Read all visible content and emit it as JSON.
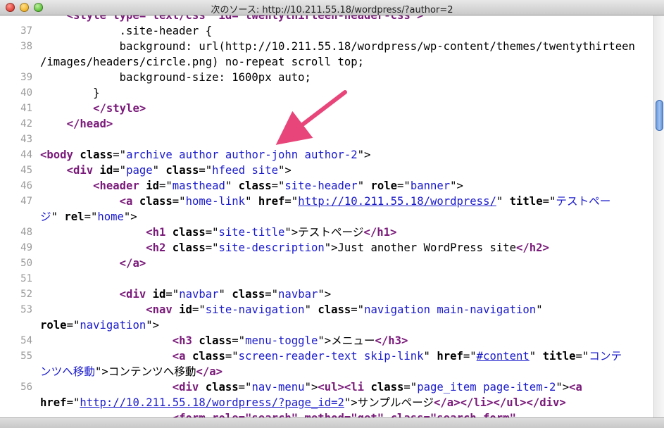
{
  "window": {
    "title": "次のソース: http://10.211.55.18/wordpress/?author=2",
    "traffic_lights": [
      "close",
      "minimize",
      "zoom"
    ]
  },
  "code_lines": [
    {
      "n": "",
      "parts": [
        {
          "t": "    <style type=\"text/css\" id=\"twentythirteen-header-css\">",
          "c": "tag"
        }
      ]
    },
    {
      "n": "37",
      "parts": [
        {
          "t": "            .site-header {",
          "c": "plain"
        }
      ]
    },
    {
      "n": "38",
      "parts": [
        {
          "t": "            background: url(http://10.211.55.18/wordpress/wp-content/themes/twentythirteen",
          "c": "plain"
        }
      ]
    },
    {
      "n": "",
      "parts": [
        {
          "t": "/images/headers/circle.png) no-repeat scroll top;",
          "c": "plain"
        }
      ]
    },
    {
      "n": "39",
      "parts": [
        {
          "t": "            background-size: 1600px auto;",
          "c": "plain"
        }
      ]
    },
    {
      "n": "40",
      "parts": [
        {
          "t": "        }",
          "c": "plain"
        }
      ]
    },
    {
      "n": "41",
      "parts": [
        {
          "t": "        ",
          "c": "plain"
        },
        {
          "t": "</style>",
          "c": "tag"
        }
      ]
    },
    {
      "n": "42",
      "parts": [
        {
          "t": "    ",
          "c": "plain"
        },
        {
          "t": "</head>",
          "c": "tag"
        }
      ]
    },
    {
      "n": "43",
      "parts": []
    },
    {
      "n": "44",
      "parts": [
        {
          "t": "<body ",
          "c": "tag"
        },
        {
          "t": "class",
          "c": "attr"
        },
        {
          "t": "=\"",
          "c": "plain"
        },
        {
          "t": "archive author author-john author-2",
          "c": "val"
        },
        {
          "t": "\">",
          "c": "plain"
        }
      ]
    },
    {
      "n": "45",
      "parts": [
        {
          "t": "    ",
          "c": "plain"
        },
        {
          "t": "<div ",
          "c": "tag"
        },
        {
          "t": "id",
          "c": "attr"
        },
        {
          "t": "=\"",
          "c": "plain"
        },
        {
          "t": "page",
          "c": "val"
        },
        {
          "t": "\" ",
          "c": "plain"
        },
        {
          "t": "class",
          "c": "attr"
        },
        {
          "t": "=\"",
          "c": "plain"
        },
        {
          "t": "hfeed site",
          "c": "val"
        },
        {
          "t": "\">",
          "c": "plain"
        }
      ]
    },
    {
      "n": "46",
      "parts": [
        {
          "t": "        ",
          "c": "plain"
        },
        {
          "t": "<header ",
          "c": "tag"
        },
        {
          "t": "id",
          "c": "attr"
        },
        {
          "t": "=\"",
          "c": "plain"
        },
        {
          "t": "masthead",
          "c": "val"
        },
        {
          "t": "\" ",
          "c": "plain"
        },
        {
          "t": "class",
          "c": "attr"
        },
        {
          "t": "=\"",
          "c": "plain"
        },
        {
          "t": "site-header",
          "c": "val"
        },
        {
          "t": "\" ",
          "c": "plain"
        },
        {
          "t": "role",
          "c": "attr"
        },
        {
          "t": "=\"",
          "c": "plain"
        },
        {
          "t": "banner",
          "c": "val"
        },
        {
          "t": "\">",
          "c": "plain"
        }
      ]
    },
    {
      "n": "47",
      "parts": [
        {
          "t": "            ",
          "c": "plain"
        },
        {
          "t": "<a ",
          "c": "tag"
        },
        {
          "t": "class",
          "c": "attr"
        },
        {
          "t": "=\"",
          "c": "plain"
        },
        {
          "t": "home-link",
          "c": "val"
        },
        {
          "t": "\" ",
          "c": "plain"
        },
        {
          "t": "href",
          "c": "attr"
        },
        {
          "t": "=\"",
          "c": "plain"
        },
        {
          "t": "http://10.211.55.18/wordpress/",
          "c": "url"
        },
        {
          "t": "\" ",
          "c": "plain"
        },
        {
          "t": "title",
          "c": "attr"
        },
        {
          "t": "=\"",
          "c": "plain"
        },
        {
          "t": "テストペー",
          "c": "val"
        }
      ]
    },
    {
      "n": "",
      "parts": [
        {
          "t": "ジ",
          "c": "val"
        },
        {
          "t": "\" ",
          "c": "plain"
        },
        {
          "t": "rel",
          "c": "attr"
        },
        {
          "t": "=\"",
          "c": "plain"
        },
        {
          "t": "home",
          "c": "val"
        },
        {
          "t": "\">",
          "c": "plain"
        }
      ]
    },
    {
      "n": "48",
      "parts": [
        {
          "t": "                ",
          "c": "plain"
        },
        {
          "t": "<h1 ",
          "c": "tag"
        },
        {
          "t": "class",
          "c": "attr"
        },
        {
          "t": "=\"",
          "c": "plain"
        },
        {
          "t": "site-title",
          "c": "val"
        },
        {
          "t": "\">テストページ",
          "c": "plain"
        },
        {
          "t": "</h1>",
          "c": "tag"
        }
      ]
    },
    {
      "n": "49",
      "parts": [
        {
          "t": "                ",
          "c": "plain"
        },
        {
          "t": "<h2 ",
          "c": "tag"
        },
        {
          "t": "class",
          "c": "attr"
        },
        {
          "t": "=\"",
          "c": "plain"
        },
        {
          "t": "site-description",
          "c": "val"
        },
        {
          "t": "\">Just another WordPress site",
          "c": "plain"
        },
        {
          "t": "</h2>",
          "c": "tag"
        }
      ]
    },
    {
      "n": "50",
      "parts": [
        {
          "t": "            ",
          "c": "plain"
        },
        {
          "t": "</a>",
          "c": "tag"
        }
      ]
    },
    {
      "n": "51",
      "parts": []
    },
    {
      "n": "52",
      "parts": [
        {
          "t": "            ",
          "c": "plain"
        },
        {
          "t": "<div ",
          "c": "tag"
        },
        {
          "t": "id",
          "c": "attr"
        },
        {
          "t": "=\"",
          "c": "plain"
        },
        {
          "t": "navbar",
          "c": "val"
        },
        {
          "t": "\" ",
          "c": "plain"
        },
        {
          "t": "class",
          "c": "attr"
        },
        {
          "t": "=\"",
          "c": "plain"
        },
        {
          "t": "navbar",
          "c": "val"
        },
        {
          "t": "\">",
          "c": "plain"
        }
      ]
    },
    {
      "n": "53",
      "parts": [
        {
          "t": "                ",
          "c": "plain"
        },
        {
          "t": "<nav ",
          "c": "tag"
        },
        {
          "t": "id",
          "c": "attr"
        },
        {
          "t": "=\"",
          "c": "plain"
        },
        {
          "t": "site-navigation",
          "c": "val"
        },
        {
          "t": "\" ",
          "c": "plain"
        },
        {
          "t": "class",
          "c": "attr"
        },
        {
          "t": "=\"",
          "c": "plain"
        },
        {
          "t": "navigation main-navigation",
          "c": "val"
        },
        {
          "t": "\"",
          "c": "plain"
        }
      ]
    },
    {
      "n": "",
      "parts": [
        {
          "t": "role",
          "c": "attr"
        },
        {
          "t": "=\"",
          "c": "plain"
        },
        {
          "t": "navigation",
          "c": "val"
        },
        {
          "t": "\">",
          "c": "plain"
        }
      ]
    },
    {
      "n": "54",
      "parts": [
        {
          "t": "                    ",
          "c": "plain"
        },
        {
          "t": "<h3 ",
          "c": "tag"
        },
        {
          "t": "class",
          "c": "attr"
        },
        {
          "t": "=\"",
          "c": "plain"
        },
        {
          "t": "menu-toggle",
          "c": "val"
        },
        {
          "t": "\">メニュー",
          "c": "plain"
        },
        {
          "t": "</h3>",
          "c": "tag"
        }
      ]
    },
    {
      "n": "55",
      "parts": [
        {
          "t": "                    ",
          "c": "plain"
        },
        {
          "t": "<a ",
          "c": "tag"
        },
        {
          "t": "class",
          "c": "attr"
        },
        {
          "t": "=\"",
          "c": "plain"
        },
        {
          "t": "screen-reader-text skip-link",
          "c": "val"
        },
        {
          "t": "\" ",
          "c": "plain"
        },
        {
          "t": "href",
          "c": "attr"
        },
        {
          "t": "=\"",
          "c": "plain"
        },
        {
          "t": "#content",
          "c": "url"
        },
        {
          "t": "\" ",
          "c": "plain"
        },
        {
          "t": "title",
          "c": "attr"
        },
        {
          "t": "=\"",
          "c": "plain"
        },
        {
          "t": "コンテ",
          "c": "val"
        }
      ]
    },
    {
      "n": "",
      "parts": [
        {
          "t": "ンツへ移動",
          "c": "val"
        },
        {
          "t": "\">コンテンツへ移動",
          "c": "plain"
        },
        {
          "t": "</a>",
          "c": "tag"
        }
      ]
    },
    {
      "n": "56",
      "parts": [
        {
          "t": "                    ",
          "c": "plain"
        },
        {
          "t": "<div ",
          "c": "tag"
        },
        {
          "t": "class",
          "c": "attr"
        },
        {
          "t": "=\"",
          "c": "plain"
        },
        {
          "t": "nav-menu",
          "c": "val"
        },
        {
          "t": "\">",
          "c": "plain"
        },
        {
          "t": "<ul>",
          "c": "tag"
        },
        {
          "t": "<li ",
          "c": "tag"
        },
        {
          "t": "class",
          "c": "attr"
        },
        {
          "t": "=\"",
          "c": "plain"
        },
        {
          "t": "page_item page-item-2",
          "c": "val"
        },
        {
          "t": "\">",
          "c": "plain"
        },
        {
          "t": "<a",
          "c": "tag"
        }
      ]
    },
    {
      "n": "",
      "parts": [
        {
          "t": "href",
          "c": "attr"
        },
        {
          "t": "=\"",
          "c": "plain"
        },
        {
          "t": "http://10.211.55.18/wordpress/?page_id=2",
          "c": "url"
        },
        {
          "t": "\">サンプルページ",
          "c": "plain"
        },
        {
          "t": "</a></li></ul></div>",
          "c": "tag"
        }
      ]
    },
    {
      "n": "",
      "parts": [
        {
          "t": "                    <form role=\"search\" method=\"get\" class=\"search-form\"",
          "c": "tag"
        }
      ]
    }
  ],
  "annotation_arrow": {
    "color": "#e8457a",
    "points_to": "author-john"
  }
}
